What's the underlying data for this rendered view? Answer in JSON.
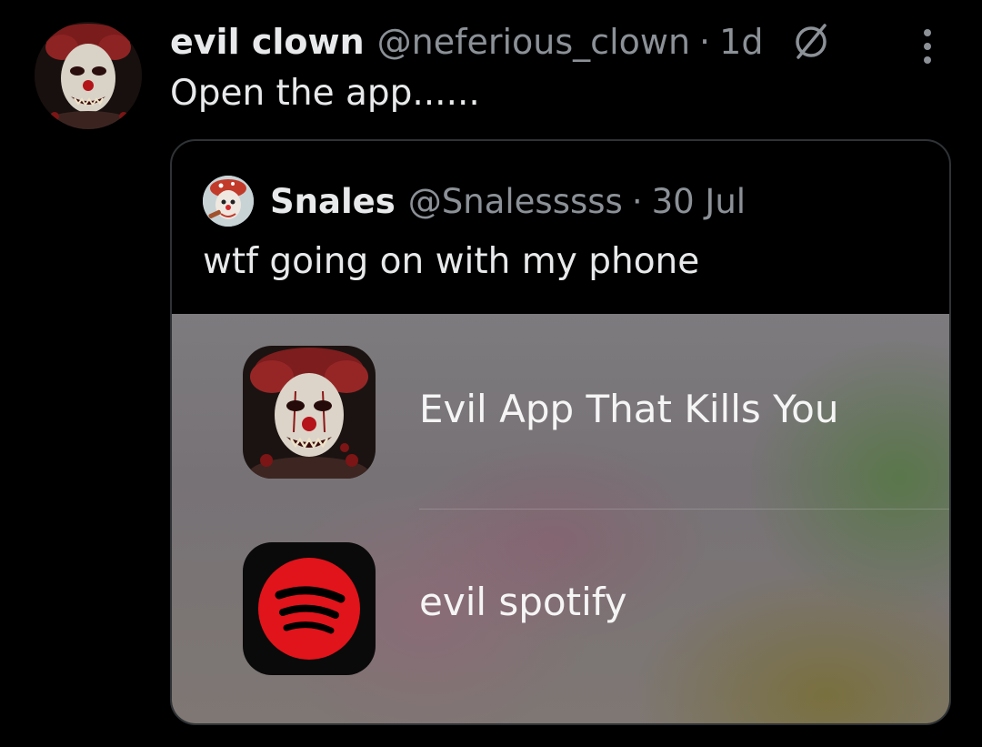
{
  "post": {
    "display_name": "evil clown",
    "handle": "@neferious_clown",
    "separator": "·",
    "time": "1d",
    "text": "Open the app......",
    "icons": {
      "avatar": "clown-avatar",
      "status": "slash-circle-icon",
      "more": "more-options-icon"
    }
  },
  "quote": {
    "display_name": "Snales",
    "handle": "@Snalesssss",
    "separator": "·",
    "date": "30 Jul",
    "text": "wtf going on with my phone"
  },
  "app_menu": {
    "items": [
      {
        "label": "Evil App That Kills You",
        "icon": "evil-clown-app-icon"
      },
      {
        "label": "evil spotify",
        "icon": "evil-spotify-icon"
      }
    ]
  },
  "colors": {
    "background": "#000000",
    "text_primary": "#e7e9ea",
    "text_secondary": "#8b9197",
    "card_border": "#2f3336",
    "spotify_red": "#e0141a"
  }
}
